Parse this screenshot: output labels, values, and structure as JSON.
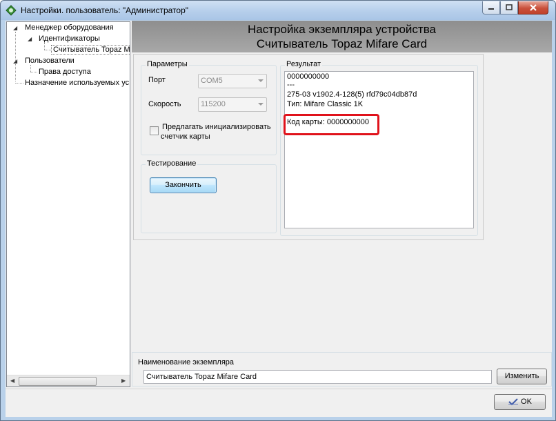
{
  "window": {
    "title": "Настройки. пользователь: \"Администратор\""
  },
  "tree": {
    "items": [
      {
        "label": "Менеджер оборудования"
      },
      {
        "label": "Идентификаторы"
      },
      {
        "label": "Считыватель Topaz M"
      },
      {
        "label": "Пользователи"
      },
      {
        "label": "Права доступа"
      },
      {
        "label": "Назначение используемых ус"
      }
    ]
  },
  "header": {
    "line1": "Настройка экземпляра устройства",
    "line2": "Считыватель Topaz Mifare Card"
  },
  "params": {
    "group_label": "Параметры",
    "port_label": "Порт",
    "port_value": "COM5",
    "speed_label": "Скорость",
    "speed_value": "115200",
    "init_checkbox_line1": "Предлагать инициализировать",
    "init_checkbox_line2": "счетчик карты",
    "init_checked": false
  },
  "testing": {
    "group_label": "Тестирование",
    "finish_button": "Закончить"
  },
  "result": {
    "group_label": "Результат",
    "lines": [
      "0000000000",
      "---",
      "275-03 v1902.4-128(5) rfd79c04db87d",
      "Тип: Mifare Classic 1K",
      "Код карты: 0000000000"
    ],
    "highlight_color": "#e0121b"
  },
  "instance": {
    "group_label": "Наименование экземпляра",
    "name_value": "Считыватель Topaz Mifare Card",
    "change_button": "Изменить"
  },
  "footer": {
    "ok_button": "OK"
  }
}
